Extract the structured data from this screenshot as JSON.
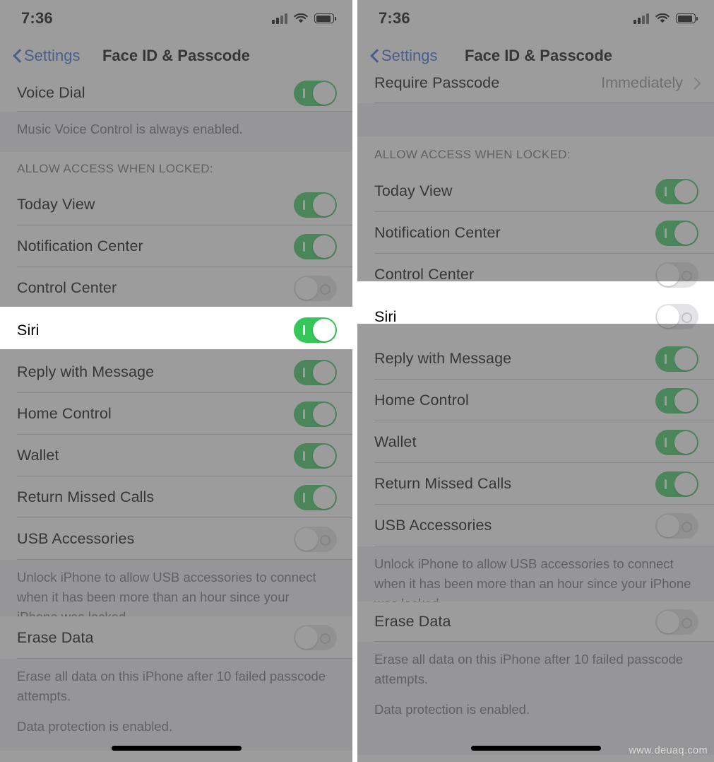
{
  "colors": {
    "ios_green": "#34c759",
    "link_blue": "#2a6ad4",
    "separator": "#c8c7cc",
    "group_bg": "#efeff4",
    "secondary_text": "#6d6d72",
    "dim_overlay": "rgba(90,90,90,0.60)"
  },
  "watermark": "www.deuaq.com",
  "left": {
    "status": {
      "time": "7:36",
      "signal_icon": "cellular-bars-icon",
      "wifi_icon": "wifi-icon",
      "battery_icon": "battery-icon"
    },
    "nav": {
      "back_label": "Settings",
      "back_icon": "chevron-left-icon",
      "title": "Face ID & Passcode"
    },
    "rows": [
      {
        "label": "Voice Dial",
        "type": "toggle",
        "state": "on"
      }
    ],
    "voice_footer": "Music Voice Control is always enabled.",
    "group_header": "ALLOW ACCESS WHEN LOCKED:",
    "access_rows": [
      {
        "label": "Today View",
        "type": "toggle",
        "state": "on"
      },
      {
        "label": "Notification Center",
        "type": "toggle",
        "state": "on"
      },
      {
        "label": "Control Center",
        "type": "toggle",
        "state": "off"
      }
    ],
    "highlight_row": {
      "label": "Siri",
      "type": "toggle",
      "state": "on"
    },
    "after_rows": [
      {
        "label": "Reply with Message",
        "type": "toggle",
        "state": "on"
      },
      {
        "label": "Home Control",
        "type": "toggle",
        "state": "on"
      },
      {
        "label": "Wallet",
        "type": "toggle",
        "state": "on"
      },
      {
        "label": "Return Missed Calls",
        "type": "toggle",
        "state": "on"
      },
      {
        "label": "USB Accessories",
        "type": "toggle",
        "state": "off"
      }
    ],
    "usb_footer": "Unlock iPhone to allow USB accessories to connect when it has been more than an hour since your iPhone was locked.",
    "erase_row": {
      "label": "Erase Data",
      "type": "toggle",
      "state": "off"
    },
    "erase_footer_1": "Erase all data on this iPhone after 10 failed passcode attempts.",
    "erase_footer_2": "Data protection is enabled."
  },
  "right": {
    "status": {
      "time": "7:36",
      "signal_icon": "cellular-bars-icon",
      "wifi_icon": "wifi-icon",
      "battery_icon": "battery-icon"
    },
    "nav": {
      "back_label": "Settings",
      "back_icon": "chevron-left-icon",
      "title": "Face ID & Passcode"
    },
    "require_row": {
      "label": "Require Passcode",
      "value": "Immediately",
      "chevron_icon": "chevron-right-icon"
    },
    "group_header": "ALLOW ACCESS WHEN LOCKED:",
    "access_rows": [
      {
        "label": "Today View",
        "type": "toggle",
        "state": "on"
      },
      {
        "label": "Notification Center",
        "type": "toggle",
        "state": "on"
      },
      {
        "label": "Control Center",
        "type": "toggle",
        "state": "off"
      }
    ],
    "highlight_row": {
      "label": "Siri",
      "type": "toggle",
      "state": "off"
    },
    "after_rows": [
      {
        "label": "Reply with Message",
        "type": "toggle",
        "state": "on"
      },
      {
        "label": "Home Control",
        "type": "toggle",
        "state": "on"
      },
      {
        "label": "Wallet",
        "type": "toggle",
        "state": "on"
      },
      {
        "label": "Return Missed Calls",
        "type": "toggle",
        "state": "on"
      },
      {
        "label": "USB Accessories",
        "type": "toggle",
        "state": "off"
      }
    ],
    "usb_footer": "Unlock iPhone to allow USB accessories to connect when it has been more than an hour since your iPhone was locked.",
    "erase_row": {
      "label": "Erase Data",
      "type": "toggle",
      "state": "off"
    },
    "erase_footer_1": "Erase all data on this iPhone after 10 failed passcode attempts.",
    "erase_footer_2": "Data protection is enabled."
  }
}
